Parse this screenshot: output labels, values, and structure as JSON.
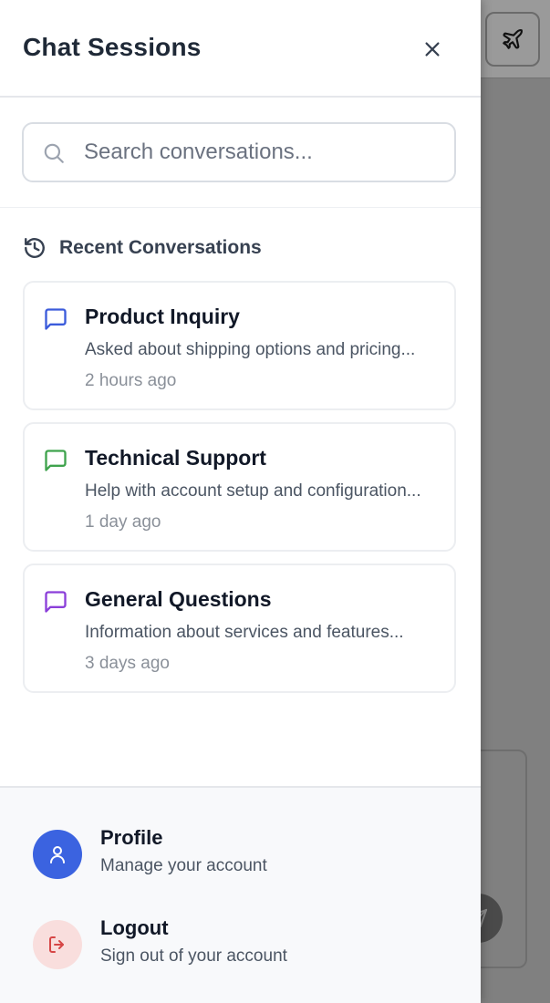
{
  "drawer": {
    "title": "Chat Sessions"
  },
  "search": {
    "placeholder": "Search conversations..."
  },
  "recent": {
    "heading": "Recent Conversations",
    "items": [
      {
        "title": "Product Inquiry",
        "preview": "Asked about shipping options and pricing...",
        "time": "2 hours ago",
        "icon": "chat-bubble-icon",
        "color": "#3b5bdb"
      },
      {
        "title": "Technical Support",
        "preview": "Help with account setup and configuration...",
        "time": "1 day ago",
        "icon": "chat-bubble-icon",
        "color": "#3fa34d"
      },
      {
        "title": "General Questions",
        "preview": "Information about services and features...",
        "time": "3 days ago",
        "icon": "chat-bubble-icon",
        "color": "#8b3fd9"
      }
    ]
  },
  "footer": {
    "profile": {
      "title": "Profile",
      "subtitle": "Manage your account",
      "icon": "user-icon",
      "color": "#3b63e0"
    },
    "logout": {
      "title": "Logout",
      "subtitle": "Sign out of your account",
      "icon": "logout-icon",
      "color": "#d64545"
    }
  }
}
